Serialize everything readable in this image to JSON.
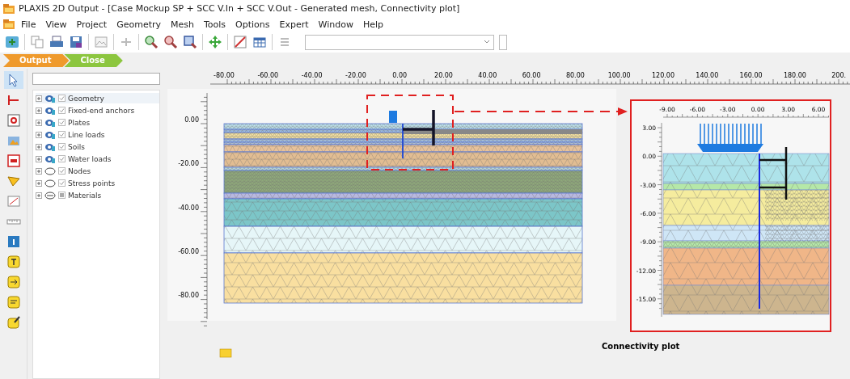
{
  "window": {
    "title": "PLAXIS 2D Output - [Case Mockup SP + SCC V.In + SCC V.Out - Generated mesh, Connectivity plot]"
  },
  "menu": [
    "File",
    "View",
    "Project",
    "Geometry",
    "Mesh",
    "Tools",
    "Options",
    "Expert",
    "Window",
    "Help"
  ],
  "phase_tabs": [
    {
      "label": "Output",
      "color": "#ef9a2c"
    },
    {
      "label": "Close",
      "color": "#8cc63f"
    }
  ],
  "tree": {
    "items": [
      {
        "kind": "layer",
        "label": "Geometry",
        "checked": true,
        "expanded": false
      },
      {
        "kind": "layer",
        "label": "Fixed-end anchors",
        "checked": true,
        "expanded": false
      },
      {
        "kind": "layer",
        "label": "Plates",
        "checked": true,
        "expanded": false
      },
      {
        "kind": "layer",
        "label": "Line loads",
        "checked": true,
        "expanded": false
      },
      {
        "kind": "layer",
        "label": "Soils",
        "checked": true,
        "expanded": false
      },
      {
        "kind": "layer",
        "label": "Water loads",
        "checked": true,
        "expanded": false
      },
      {
        "kind": "points",
        "label": "Nodes",
        "checked": true,
        "expanded": false
      },
      {
        "kind": "points",
        "label": "Stress points",
        "checked": true,
        "expanded": false
      },
      {
        "kind": "materials",
        "label": "Materials",
        "checked": false,
        "expanded": false
      }
    ]
  },
  "plot": {
    "x_ticks": [
      "-80.00",
      "-60.00",
      "-40.00",
      "-20.00",
      "0.00",
      "20.00",
      "40.00",
      "60.00",
      "80.00",
      "100.00",
      "120.00",
      "140.00",
      "160.00",
      "180.00",
      "200."
    ],
    "y_ticks": [
      "0.00",
      "-20.00",
      "-40.00",
      "-60.00",
      "-80.00"
    ],
    "inset": {
      "x_ticks": [
        "-9.00",
        "-6.00",
        "-3.00",
        "0.00",
        "3.00",
        "6.00"
      ],
      "y_ticks": [
        "3.00",
        "0.00",
        "-3.00",
        "-6.00",
        "-9.00",
        "-12.00",
        "-15.00"
      ]
    },
    "caption": "Connectivity plot"
  }
}
